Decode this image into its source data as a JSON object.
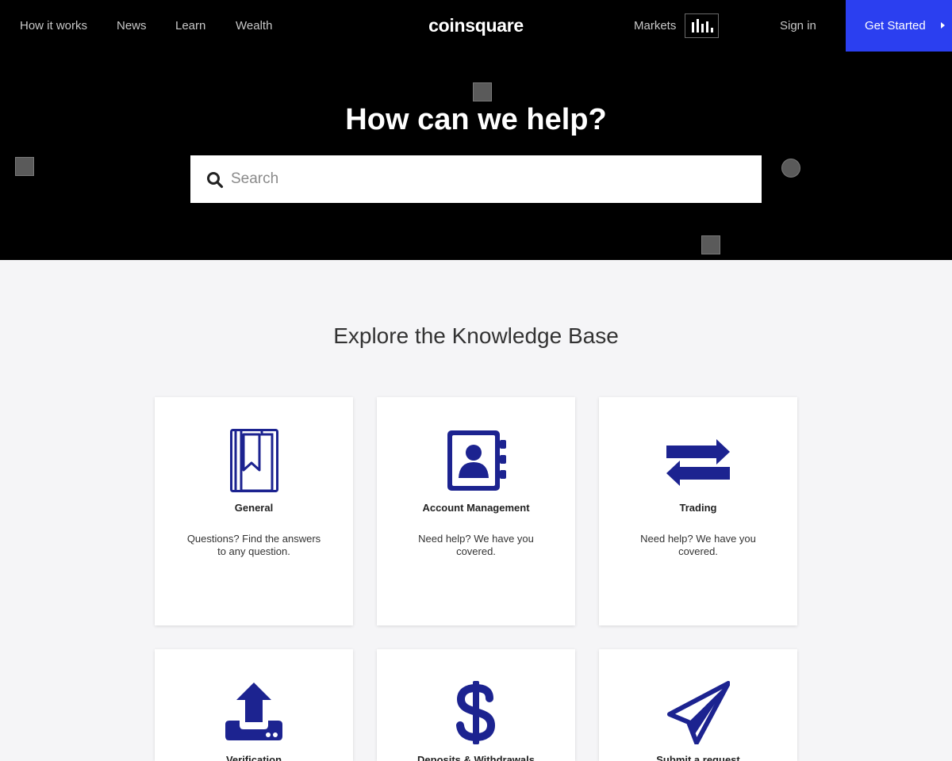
{
  "nav": {
    "links": [
      "How it works",
      "News",
      "Learn",
      "Wealth"
    ],
    "logo": "coinsquare",
    "markets_label": "Markets",
    "markets_icon": "bar-chart-icon",
    "sign_in": "Sign in",
    "get_started": "Get Started"
  },
  "hero": {
    "title": "How can we help?",
    "search_placeholder": "Search",
    "search_value": ""
  },
  "kb": {
    "title": "Explore the Knowledge Base",
    "cards": [
      {
        "title": "General",
        "description": "Questions? Find the answers to any question.",
        "icon": "book-bookmark-icon"
      },
      {
        "title": "Account Management",
        "description": "Need help? We have you covered.",
        "icon": "contact-book-icon"
      },
      {
        "title": "Trading",
        "description": "Need help? We have you covered.",
        "icon": "exchange-arrows-icon"
      },
      {
        "title": "Verification",
        "description": "",
        "icon": "upload-tray-icon"
      },
      {
        "title": "Deposits & Withdrawals",
        "description": "",
        "icon": "dollar-sign-icon"
      },
      {
        "title": "Submit a request",
        "description": "",
        "icon": "paper-plane-icon"
      }
    ]
  },
  "colors": {
    "hero_bg": "#000000",
    "accent": "#2b3ff0",
    "icon": "#1c2390",
    "page_bg": "#f5f5f7"
  }
}
